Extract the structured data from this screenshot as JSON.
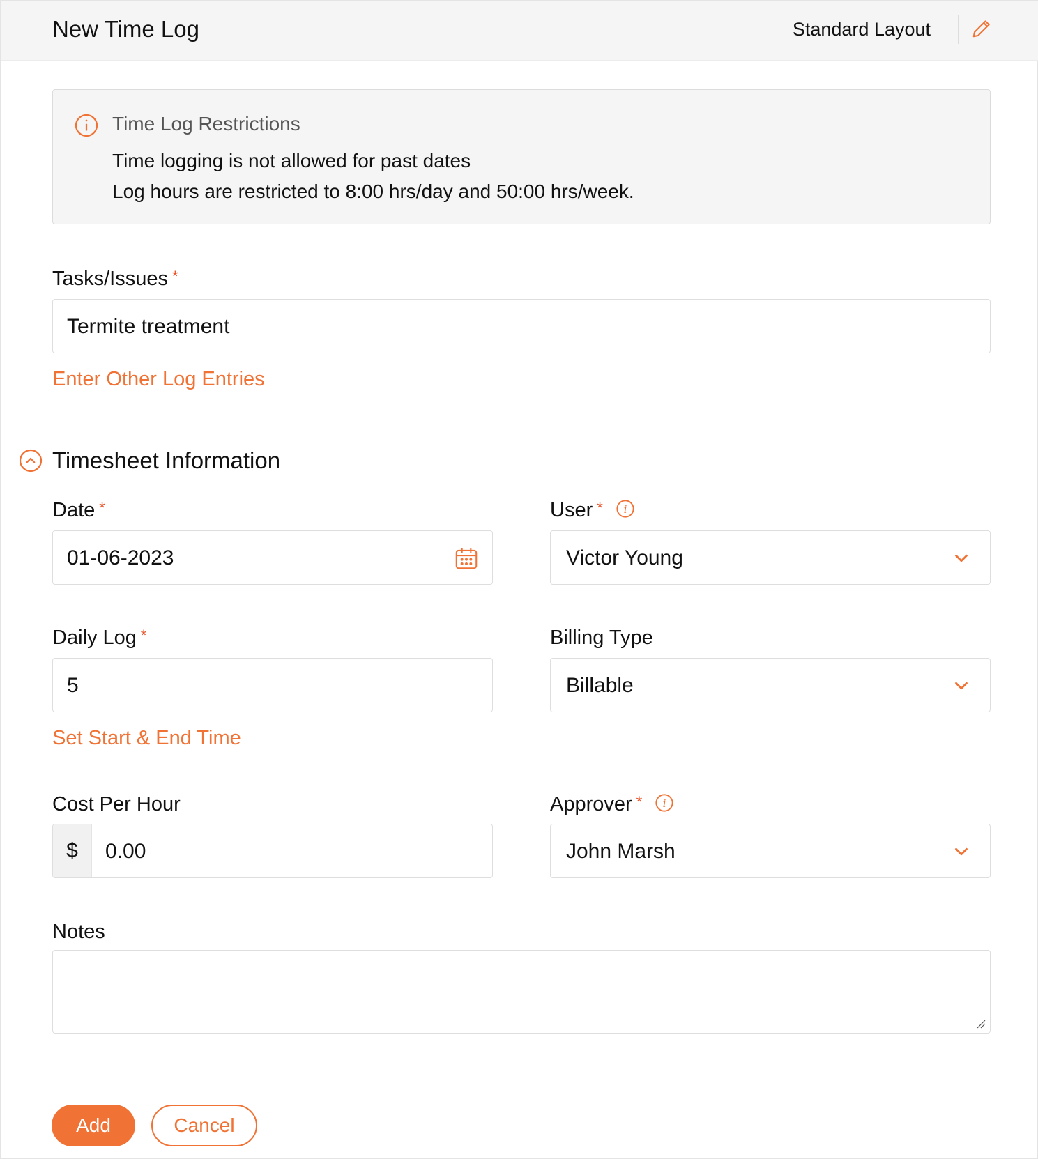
{
  "header": {
    "title": "New Time Log",
    "layout_label": "Standard Layout",
    "edit_icon": "pencil-icon"
  },
  "notice": {
    "icon": "info-circle-icon",
    "title": "Time Log Restrictions",
    "line1": "Time logging is not allowed for past dates",
    "line2": "Log hours are restricted to 8:00 hrs/day and 50:00 hrs/week."
  },
  "tasks": {
    "label": "Tasks/Issues",
    "required_mark": "*",
    "value": "Termite treatment",
    "link": "Enter Other Log Entries"
  },
  "section": {
    "title": "Timesheet Information",
    "collapse_icon": "chevron-up-circle-icon"
  },
  "date": {
    "label": "Date",
    "required_mark": "*",
    "value": "01-06-2023",
    "icon": "calendar-icon"
  },
  "user": {
    "label": "User",
    "required_mark": "*",
    "value": "Victor Young",
    "info_icon": "info-icon"
  },
  "daily_log": {
    "label": "Daily Log",
    "required_mark": "*",
    "value": "5",
    "link": "Set Start & End Time"
  },
  "billing_type": {
    "label": "Billing Type",
    "value": "Billable"
  },
  "cost_per_hour": {
    "label": "Cost Per Hour",
    "currency": "$",
    "value": "0.00"
  },
  "approver": {
    "label": "Approver",
    "required_mark": "*",
    "value": "John Marsh",
    "info_icon": "info-icon"
  },
  "notes": {
    "label": "Notes",
    "value": ""
  },
  "actions": {
    "add": "Add",
    "cancel": "Cancel"
  },
  "colors": {
    "accent": "#f07234",
    "required": "#e8542a",
    "header_bg": "#f5f5f5"
  }
}
